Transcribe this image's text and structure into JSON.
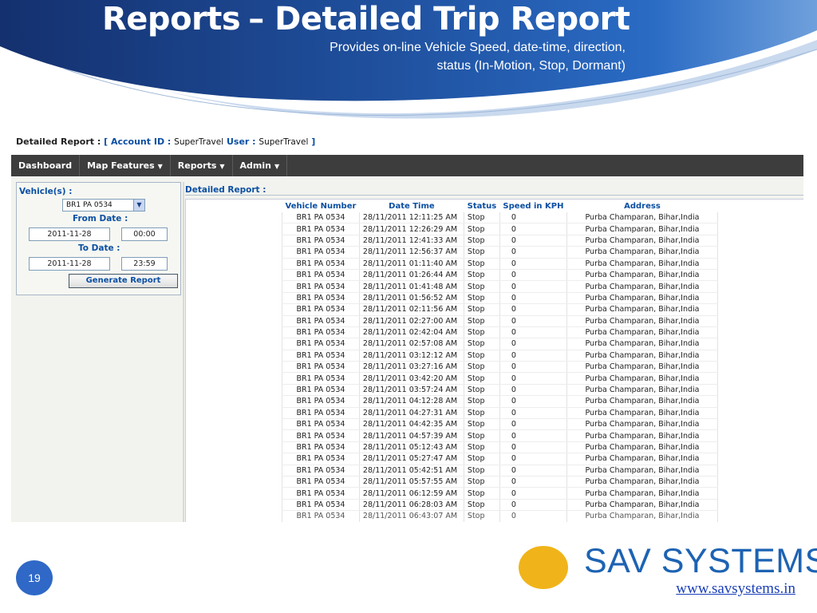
{
  "slide": {
    "title_part1": "Reports",
    "title_part2": "– Detailed Trip Report",
    "subtitle_line1": "Provides on-line Vehicle Speed, date-time, direction,",
    "subtitle_line2": "status (In-Motion, Stop, Dormant)",
    "page_number": "19",
    "brand_name": "SAV SYSTEMS",
    "brand_url": "www.savsystems.in",
    "colors": {
      "header_blue": "#1f4f9c",
      "brand_blue": "#1d63b3",
      "logo_yellow": "#f0b41a"
    }
  },
  "app": {
    "report_label": "Detailed Report :",
    "bracket_open": "[",
    "account_label": "Account ID :",
    "account_value": "SuperTravel",
    "user_label": "User :",
    "user_value": "SuperTravel",
    "bracket_close": "]",
    "nav": [
      {
        "label": "Dashboard",
        "caret": ""
      },
      {
        "label": "Map Features",
        "caret": "▼"
      },
      {
        "label": "Reports",
        "caret": "▼"
      },
      {
        "label": "Admin",
        "caret": "▼"
      }
    ],
    "form": {
      "vehicle_label": "Vehicle(s) :",
      "vehicle_selected": "BR1 PA 0534",
      "from_label": "From Date :",
      "from_date": "2011-11-28",
      "from_time": "00:00",
      "to_label": "To Date :",
      "to_date": "2011-11-28",
      "to_time": "23:59",
      "generate_label": "Generate Report"
    },
    "report_title": "Detailed Report :",
    "columns": [
      "Vehicle Number",
      "Date Time",
      "Status",
      "Speed in KPH",
      "Address"
    ],
    "rows": [
      [
        "BR1 PA 0534",
        "28/11/2011 12:11:25 AM",
        "Stop",
        "0",
        "Purba Champaran, Bihar,India"
      ],
      [
        "BR1 PA 0534",
        "28/11/2011 12:26:29 AM",
        "Stop",
        "0",
        "Purba Champaran, Bihar,India"
      ],
      [
        "BR1 PA 0534",
        "28/11/2011 12:41:33 AM",
        "Stop",
        "0",
        "Purba Champaran, Bihar,India"
      ],
      [
        "BR1 PA 0534",
        "28/11/2011 12:56:37 AM",
        "Stop",
        "0",
        "Purba Champaran, Bihar,India"
      ],
      [
        "BR1 PA 0534",
        "28/11/2011 01:11:40 AM",
        "Stop",
        "0",
        "Purba Champaran, Bihar,India"
      ],
      [
        "BR1 PA 0534",
        "28/11/2011 01:26:44 AM",
        "Stop",
        "0",
        "Purba Champaran, Bihar,India"
      ],
      [
        "BR1 PA 0534",
        "28/11/2011 01:41:48 AM",
        "Stop",
        "0",
        "Purba Champaran, Bihar,India"
      ],
      [
        "BR1 PA 0534",
        "28/11/2011 01:56:52 AM",
        "Stop",
        "0",
        "Purba Champaran, Bihar,India"
      ],
      [
        "BR1 PA 0534",
        "28/11/2011 02:11:56 AM",
        "Stop",
        "0",
        "Purba Champaran, Bihar,India"
      ],
      [
        "BR1 PA 0534",
        "28/11/2011 02:27:00 AM",
        "Stop",
        "0",
        "Purba Champaran, Bihar,India"
      ],
      [
        "BR1 PA 0534",
        "28/11/2011 02:42:04 AM",
        "Stop",
        "0",
        "Purba Champaran, Bihar,India"
      ],
      [
        "BR1 PA 0534",
        "28/11/2011 02:57:08 AM",
        "Stop",
        "0",
        "Purba Champaran, Bihar,India"
      ],
      [
        "BR1 PA 0534",
        "28/11/2011 03:12:12 AM",
        "Stop",
        "0",
        "Purba Champaran, Bihar,India"
      ],
      [
        "BR1 PA 0534",
        "28/11/2011 03:27:16 AM",
        "Stop",
        "0",
        "Purba Champaran, Bihar,India"
      ],
      [
        "BR1 PA 0534",
        "28/11/2011 03:42:20 AM",
        "Stop",
        "0",
        "Purba Champaran, Bihar,India"
      ],
      [
        "BR1 PA 0534",
        "28/11/2011 03:57:24 AM",
        "Stop",
        "0",
        "Purba Champaran, Bihar,India"
      ],
      [
        "BR1 PA 0534",
        "28/11/2011 04:12:28 AM",
        "Stop",
        "0",
        "Purba Champaran, Bihar,India"
      ],
      [
        "BR1 PA 0534",
        "28/11/2011 04:27:31 AM",
        "Stop",
        "0",
        "Purba Champaran, Bihar,India"
      ],
      [
        "BR1 PA 0534",
        "28/11/2011 04:42:35 AM",
        "Stop",
        "0",
        "Purba Champaran, Bihar,India"
      ],
      [
        "BR1 PA 0534",
        "28/11/2011 04:57:39 AM",
        "Stop",
        "0",
        "Purba Champaran, Bihar,India"
      ],
      [
        "BR1 PA 0534",
        "28/11/2011 05:12:43 AM",
        "Stop",
        "0",
        "Purba Champaran, Bihar,India"
      ],
      [
        "BR1 PA 0534",
        "28/11/2011 05:27:47 AM",
        "Stop",
        "0",
        "Purba Champaran, Bihar,India"
      ],
      [
        "BR1 PA 0534",
        "28/11/2011 05:42:51 AM",
        "Stop",
        "0",
        "Purba Champaran, Bihar,India"
      ],
      [
        "BR1 PA 0534",
        "28/11/2011 05:57:55 AM",
        "Stop",
        "0",
        "Purba Champaran, Bihar,India"
      ],
      [
        "BR1 PA 0534",
        "28/11/2011 06:12:59 AM",
        "Stop",
        "0",
        "Purba Champaran, Bihar,India"
      ],
      [
        "BR1 PA 0534",
        "28/11/2011 06:28:03 AM",
        "Stop",
        "0",
        "Purba Champaran, Bihar,India"
      ],
      [
        "BR1 PA 0534",
        "28/11/2011 06:43:07 AM",
        "Stop",
        "0",
        "Purba Champaran, Bihar,India"
      ]
    ]
  }
}
